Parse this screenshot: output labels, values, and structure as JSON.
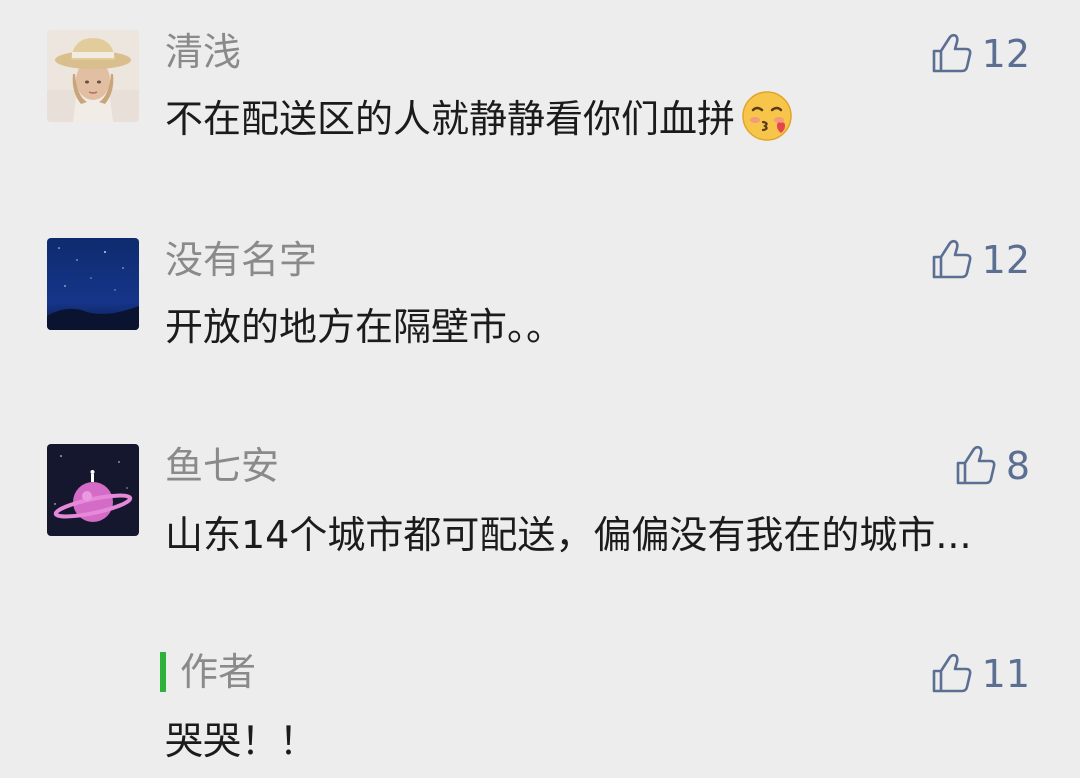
{
  "colors": {
    "background": "#ededed",
    "name": "#8a8a8a",
    "text": "#1b1b1b",
    "like": "#5b6f93",
    "author_accent": "#2fb23c"
  },
  "comments": [
    {
      "name": "清浅",
      "text": "不在配送区的人就静静看你们血拼",
      "emoji": "kissing-face-with-closed-eyes-emoji",
      "likes": "12",
      "avatar": "girl-with-straw-hat-avatar"
    },
    {
      "name": "没有名字",
      "text": "开放的地方在隔壁市。。",
      "likes": "12",
      "avatar": "night-sky-avatar"
    },
    {
      "name": "鱼七安",
      "text": "山东14个城市都可配送，偏偏没有我在的城市...",
      "likes": "8",
      "avatar": "pink-planet-avatar"
    }
  ],
  "author_reply": {
    "name": "作者",
    "text": "哭哭！！",
    "likes": "11"
  },
  "icons": {
    "like": "thumbs-up-icon"
  }
}
